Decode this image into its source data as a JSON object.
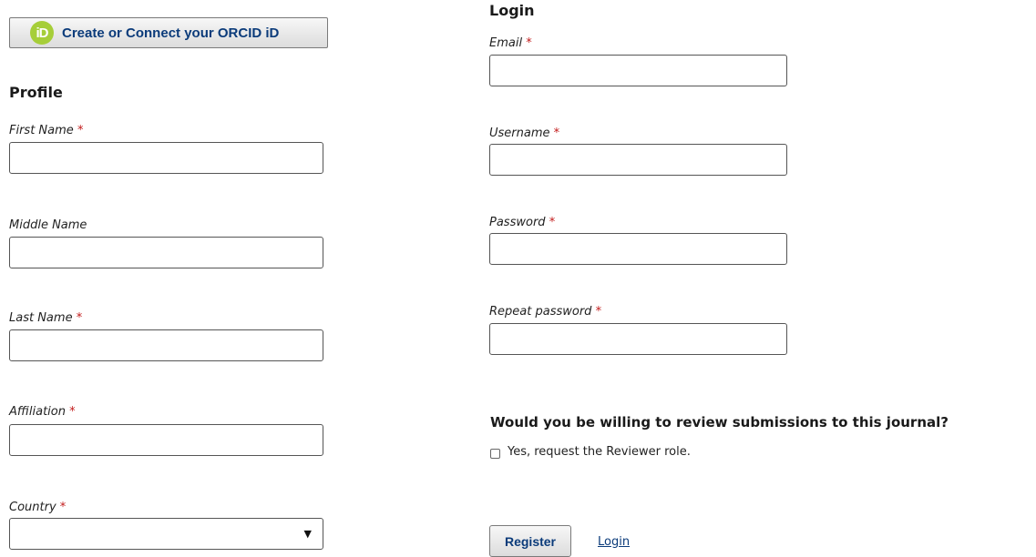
{
  "orcid": {
    "icon": "iD",
    "label": "Create or Connect your ORCID iD"
  },
  "profile": {
    "title": "Profile",
    "fields": {
      "first_name": {
        "label": "First Name",
        "required": "*",
        "value": ""
      },
      "middle_name": {
        "label": "Middle Name",
        "value": ""
      },
      "last_name": {
        "label": "Last Name",
        "required": "*",
        "value": ""
      },
      "affiliation": {
        "label": "Affiliation",
        "required": "*",
        "value": ""
      },
      "country": {
        "label": "Country",
        "required": "*",
        "value": ""
      }
    }
  },
  "login": {
    "title": "Login",
    "fields": {
      "email": {
        "label": "Email",
        "required": "*",
        "value": ""
      },
      "username": {
        "label": "Username",
        "required": "*",
        "value": ""
      },
      "password": {
        "label": "Password",
        "required": "*",
        "value": ""
      },
      "repeat_password": {
        "label": "Repeat password",
        "required": "*",
        "value": ""
      }
    }
  },
  "reviewer": {
    "question": "Would you be willing to review submissions to this journal?",
    "checkbox_label": "Yes, request the Reviewer role.",
    "checked": false
  },
  "actions": {
    "register_label": "Register",
    "login_link": "Login"
  },
  "colors": {
    "orcid_green": "#a6ce39",
    "link_blue": "#0b3b7a",
    "required_red": "#c21a1a"
  },
  "icons": {
    "select_caret": "▼"
  }
}
